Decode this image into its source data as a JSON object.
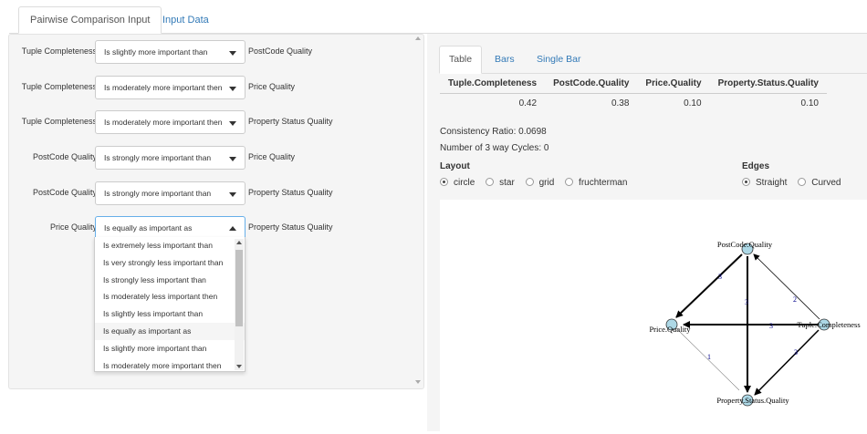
{
  "tabs": [
    "Pairwise Comparison Input",
    "Input Data"
  ],
  "comparisons": [
    {
      "left": "Tuple Completeness",
      "value": "Is slightly more important than",
      "right": "PostCode Quality"
    },
    {
      "left": "Tuple Completeness",
      "value": "Is moderately more important then",
      "right": "Price Quality"
    },
    {
      "left": "Tuple Completeness",
      "value": "Is moderately more important then",
      "right": "Property Status Quality"
    },
    {
      "left": "PostCode Quality",
      "value": "Is strongly more important than",
      "right": "Price Quality"
    },
    {
      "left": "PostCode Quality",
      "value": "Is strongly more important than",
      "right": "Property Status Quality"
    },
    {
      "left": "Price Quality",
      "value": "Is equally as important as",
      "right": "Property Status Quality"
    }
  ],
  "dropdown_options": [
    "Is extremely less important than",
    "Is very strongly less important than",
    "Is strongly less important than",
    "Is moderately less important then",
    "Is slightly less important than",
    "Is equally as important as",
    "Is slightly more important than",
    "Is moderately more important then"
  ],
  "result_tabs": [
    "Table",
    "Bars",
    "Single Bar"
  ],
  "table": {
    "headers": [
      "Tuple.Completeness",
      "PostCode.Quality",
      "Price.Quality",
      "Property.Status.Quality"
    ],
    "values": [
      "0.42",
      "0.38",
      "0.10",
      "0.10"
    ]
  },
  "consistency_ratio": "Consistency Ratio: 0.0698",
  "cycles": "Number of 3 way Cycles: 0",
  "layout": {
    "label": "Layout",
    "options": [
      "circle",
      "star",
      "grid",
      "fruchterman"
    ],
    "selected": "circle"
  },
  "edges": {
    "label": "Edges",
    "options": [
      "Straight",
      "Curved"
    ],
    "selected": "Straight"
  },
  "graph": {
    "nodes": [
      "PostCode.Quality",
      "Price.Quality",
      "Tuple.Completeness",
      "Property.Status.Quality"
    ],
    "edge_labels": [
      "3",
      "3",
      "2",
      "3",
      "3",
      "1"
    ],
    "node_color": "#add8e6",
    "label_color": "#00008b"
  }
}
